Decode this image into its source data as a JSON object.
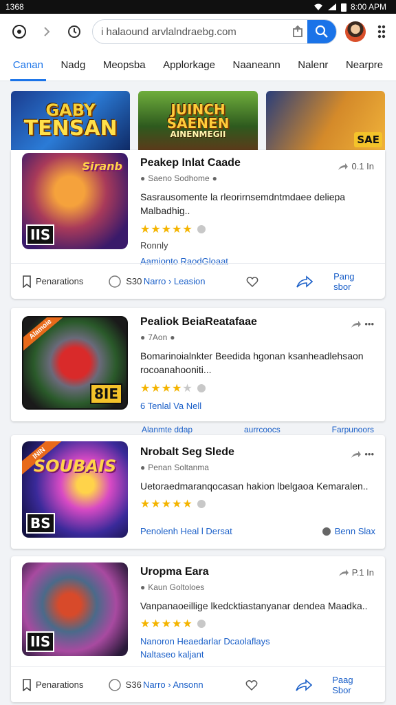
{
  "status": {
    "left": "1368",
    "time": "8:00 APM"
  },
  "browser": {
    "url": "i halaound arvlalndraebg.com"
  },
  "tabs": [
    "Canan",
    "Nadg",
    "Meopsba",
    "Applorkage",
    "Naaneann",
    "Nalenr",
    "Nearpre"
  ],
  "banners": {
    "b1_line1": "GABY",
    "b1_line2": "TENSAN",
    "b2_line1": "JUINCH",
    "b2_line2": "SAENEN",
    "b2_line3": "AINENMEGII",
    "b3_badge": "SAE"
  },
  "cards": [
    {
      "title": "Peakep Inlat Caade",
      "meta": "Saeno  Sodhome",
      "corner": "0.1 In",
      "desc": "Sasrausomente la rleorirnsemdntmdaee deliepa Malbadhig..",
      "stars": "★★★★★",
      "note": "Ronnly",
      "link": "Aamionto RaodGloaat",
      "thumb_title": "Siranb",
      "thumb_tag": "IIS"
    },
    {
      "title": "Pealiok BeiaReatafaae",
      "meta": "7Aon",
      "corner": "•••",
      "desc": "Bomarinoialnkter Beedida hgonan ksanheadlehsaon rocoanahooniti...",
      "stars": "★★★★",
      "stars_empty": "★",
      "link": "6 Tenlal Va Nell",
      "thumb_ribbon": "Alamoie",
      "thumb_tag": "8IE"
    },
    {
      "title": "Nrobalt Seg Slede",
      "meta": "Penan  Soltanma",
      "corner": "•••",
      "desc": "Uetoraedmaranqocasan hakion lbelgaoa Kemaralen..",
      "stars": "★★★★★",
      "link": "Penolenh Heal l Dersat",
      "link_right": "Benn Slax",
      "thumb_ribbon": "ININ",
      "thumb_title": "SOUBAIS",
      "thumb_tag": "BS"
    },
    {
      "title": "Uropma Eara",
      "meta": "Kaun  Goltoloes",
      "corner": "P.1 In",
      "desc": "Vanpanaoeillige lkedcktiastanyanar dendea Maadka..",
      "stars": "★★★★★",
      "link": "Nanoron Heaedarlar Dcaolaflays",
      "link2": "Naltaseo kaljant",
      "thumb_tag": "IIS"
    }
  ],
  "between": {
    "left": "Alanmte ddap",
    "mid": "aurrcoocs",
    "right": "Farpunoors"
  },
  "actions": {
    "a1": "Penarations",
    "a2": "S30",
    "a3": "Narro › Leasion",
    "a4": "Pang sbor"
  },
  "actions_b": {
    "a1": "Penarations",
    "a2": "S36",
    "a3": "Narro › Ansonn",
    "a4": "Paag Sbor"
  }
}
